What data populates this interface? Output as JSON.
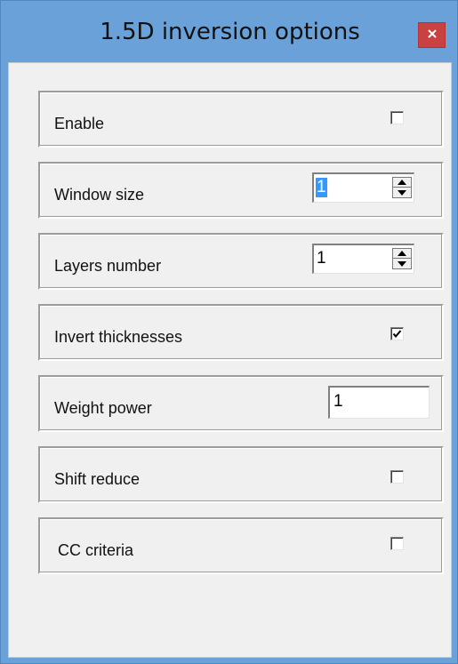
{
  "window": {
    "title": "1.5D inversion options",
    "close_glyph": "×"
  },
  "options": {
    "enable": {
      "label": "Enable",
      "checked": false
    },
    "window_size": {
      "label": "Window size",
      "value": "1"
    },
    "layers_number": {
      "label": "Layers number",
      "value": "1"
    },
    "invert_thicknesses": {
      "label": "Invert thicknesses",
      "checked": true
    },
    "weight_power": {
      "label": "Weight power",
      "value": "1"
    },
    "shift_reduce": {
      "label": "Shift reduce",
      "checked": false
    },
    "cc_criteria": {
      "label": "CC criteria",
      "checked": false
    }
  },
  "colors": {
    "titlebar": "#6aa1d8",
    "close_button": "#c94141",
    "client_background": "#f0f0f0",
    "selection": "#3399ff"
  },
  "icons": {
    "close": "close-icon",
    "spin_up": "triangle-up-icon",
    "spin_down": "triangle-down-icon",
    "check": "checkmark-icon"
  }
}
